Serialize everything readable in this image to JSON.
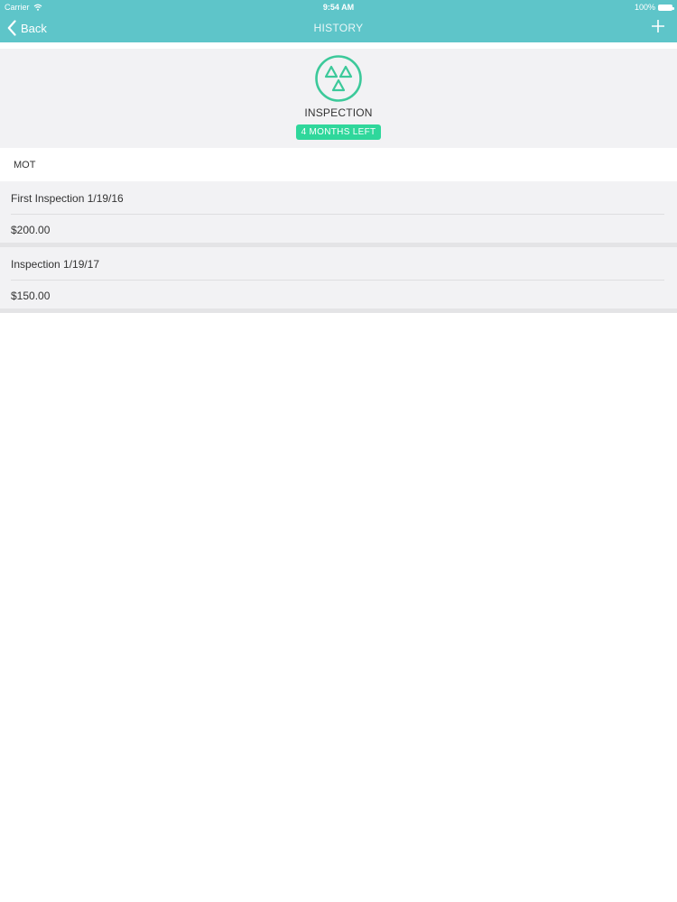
{
  "status_bar": {
    "carrier": "Carrier",
    "time": "9:54 AM",
    "battery": "100%"
  },
  "nav": {
    "back_label": "Back",
    "title": "HISTORY",
    "add_icon": "plus-icon",
    "back_icon": "chevron-left-icon"
  },
  "header": {
    "icon": "inspection-triangles-icon",
    "title": "INSPECTION",
    "badge": "4 MONTHS LEFT"
  },
  "section": {
    "label": "MOT"
  },
  "history": [
    {
      "title": "First Inspection 1/19/16",
      "amount": "$200.00"
    },
    {
      "title": "Inspection 1/19/17",
      "amount": "$150.00"
    }
  ],
  "colors": {
    "nav_bg": "#5ec5c9",
    "accent": "#2fd79b",
    "icon_stroke": "#3cc99a",
    "panel_bg": "#f2f2f4"
  }
}
